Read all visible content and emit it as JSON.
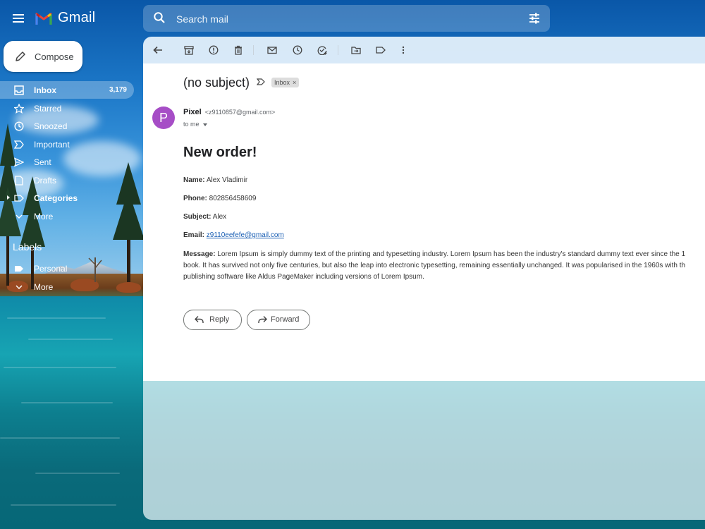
{
  "app": {
    "name": "Gmail",
    "accent": "#ea4335"
  },
  "search": {
    "placeholder": "Search mail"
  },
  "sidebar": {
    "compose_label": "Compose",
    "items": [
      {
        "label": "Inbox",
        "count": "3,179",
        "icon": "inbox-icon"
      },
      {
        "label": "Starred",
        "icon": "star-icon"
      },
      {
        "label": "Snoozed",
        "icon": "clock-icon"
      },
      {
        "label": "Important",
        "icon": "important-icon"
      },
      {
        "label": "Sent",
        "icon": "send-icon"
      },
      {
        "label": "Drafts",
        "icon": "draft-icon"
      },
      {
        "label": "Categories",
        "icon": "label-icon"
      },
      {
        "label": "More",
        "icon": "chevron-down-icon"
      }
    ],
    "labels_heading": "Labels",
    "labels": [
      {
        "label": "Personal",
        "icon": "label-icon"
      },
      {
        "label": "More",
        "icon": "chevron-down-icon"
      }
    ]
  },
  "toolbar": {
    "icons": [
      "back-icon",
      "archive-icon",
      "report-spam-icon",
      "delete-icon",
      "mark-unread-icon",
      "snooze-icon",
      "add-task-icon",
      "move-to-icon",
      "labels-icon",
      "more-vert-icon"
    ]
  },
  "email": {
    "subject": "(no subject)",
    "folder_chip": "Inbox",
    "chip_close": "×",
    "sender_initial": "P",
    "sender_name": "Pixel",
    "sender_email": "<z9110857@gmail.com>",
    "recipient": "to me",
    "heading": "New order!",
    "fields": {
      "name_label": "Name:",
      "name_value": "Alex Vladimir",
      "phone_label": "Phone:",
      "phone_value": "802856458609",
      "subject_label": "Subject:",
      "subject_value": "Alex",
      "email_label": "Email:",
      "email_value": "z9110eefefe@gmail.com",
      "message_label": "Message:",
      "message_line1": "Lorem Ipsum is simply dummy text of the printing and typesetting industry. Lorem Ipsum has been the industry's standard dummy text ever since the 1",
      "message_line2": "book. It has survived not only five centuries, but also the leap into electronic typesetting, remaining essentially unchanged. It was popularised in the 1960s with th",
      "message_line3": "publishing software like Aldus PageMaker including versions of Lorem Ipsum."
    },
    "reply_label": "Reply",
    "forward_label": "Forward",
    "avatar_color": "#a64dc6"
  }
}
